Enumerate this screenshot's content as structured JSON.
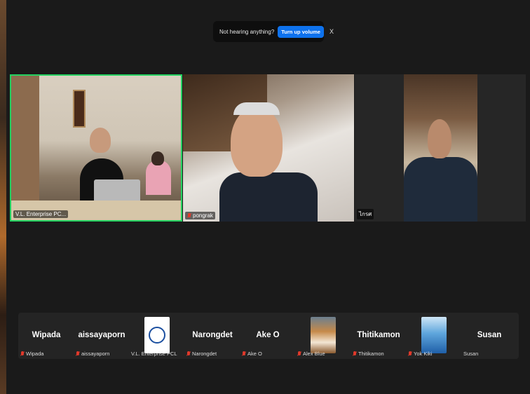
{
  "notice": {
    "message": "Not hearing anything?",
    "button": "Turn up volume",
    "close": "X"
  },
  "video_tiles": [
    {
      "name": "V.L. Enterprise PC...",
      "muted": false,
      "active_speaker": true
    },
    {
      "name": "pongrak",
      "muted": true,
      "active_speaker": false
    },
    {
      "name": "ไกรศ",
      "muted": false,
      "active_speaker": false
    }
  ],
  "participants": [
    {
      "display": "Wipada",
      "label": "Wipada",
      "muted": true
    },
    {
      "display": "aissayaporn",
      "label": "aissayaporn",
      "muted": true
    },
    {
      "display": "",
      "label": "V.L. Enterprise PCL",
      "muted": false,
      "avatar": "company-logo"
    },
    {
      "display": "Narongdet",
      "label": "Narongdet",
      "muted": true
    },
    {
      "display": "Ake O",
      "label": "Ake O",
      "muted": true
    },
    {
      "display": "",
      "label": "Alex Blue",
      "muted": true,
      "avatar": "dog-photo"
    },
    {
      "display": "Thitikamon",
      "label": "Thitikamon",
      "muted": true
    },
    {
      "display": "",
      "label": "Yok Kiki",
      "muted": true,
      "avatar": "sky-photo"
    },
    {
      "display": "Susan",
      "label": "Susan",
      "muted": false
    }
  ],
  "colors": {
    "accent": "#0e72ed",
    "active_border": "#23d160",
    "muted_mic": "#e0392b",
    "background": "#1a1a1a"
  }
}
